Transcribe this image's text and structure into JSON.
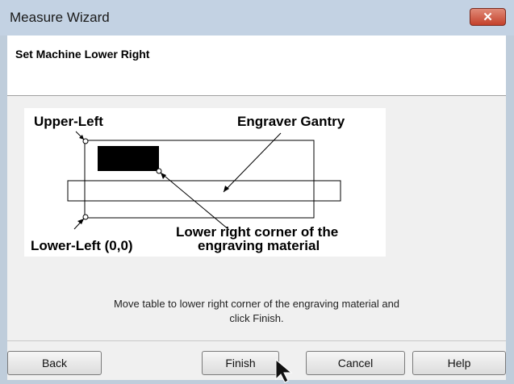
{
  "window": {
    "title": "Measure Wizard",
    "close_label": "✕"
  },
  "header": {
    "title": "Set Machine Lower Right"
  },
  "diagram": {
    "labels": {
      "upper_left": "Upper-Left",
      "gantry": "Engraver Gantry",
      "lower_right_line1": "Lower right corner of the",
      "lower_right_line2": "engraving material",
      "lower_left": "Lower-Left (0,0)"
    }
  },
  "instruction": {
    "line1": "Move table to lower right corner of the engraving material and",
    "line2": "click Finish."
  },
  "buttons": {
    "back": "Back",
    "finish": "Finish",
    "cancel": "Cancel",
    "help": "Help"
  },
  "colors": {
    "titlebar": "#c3d2e3",
    "close": "#c4412b",
    "panel": "#f0f0f0"
  }
}
